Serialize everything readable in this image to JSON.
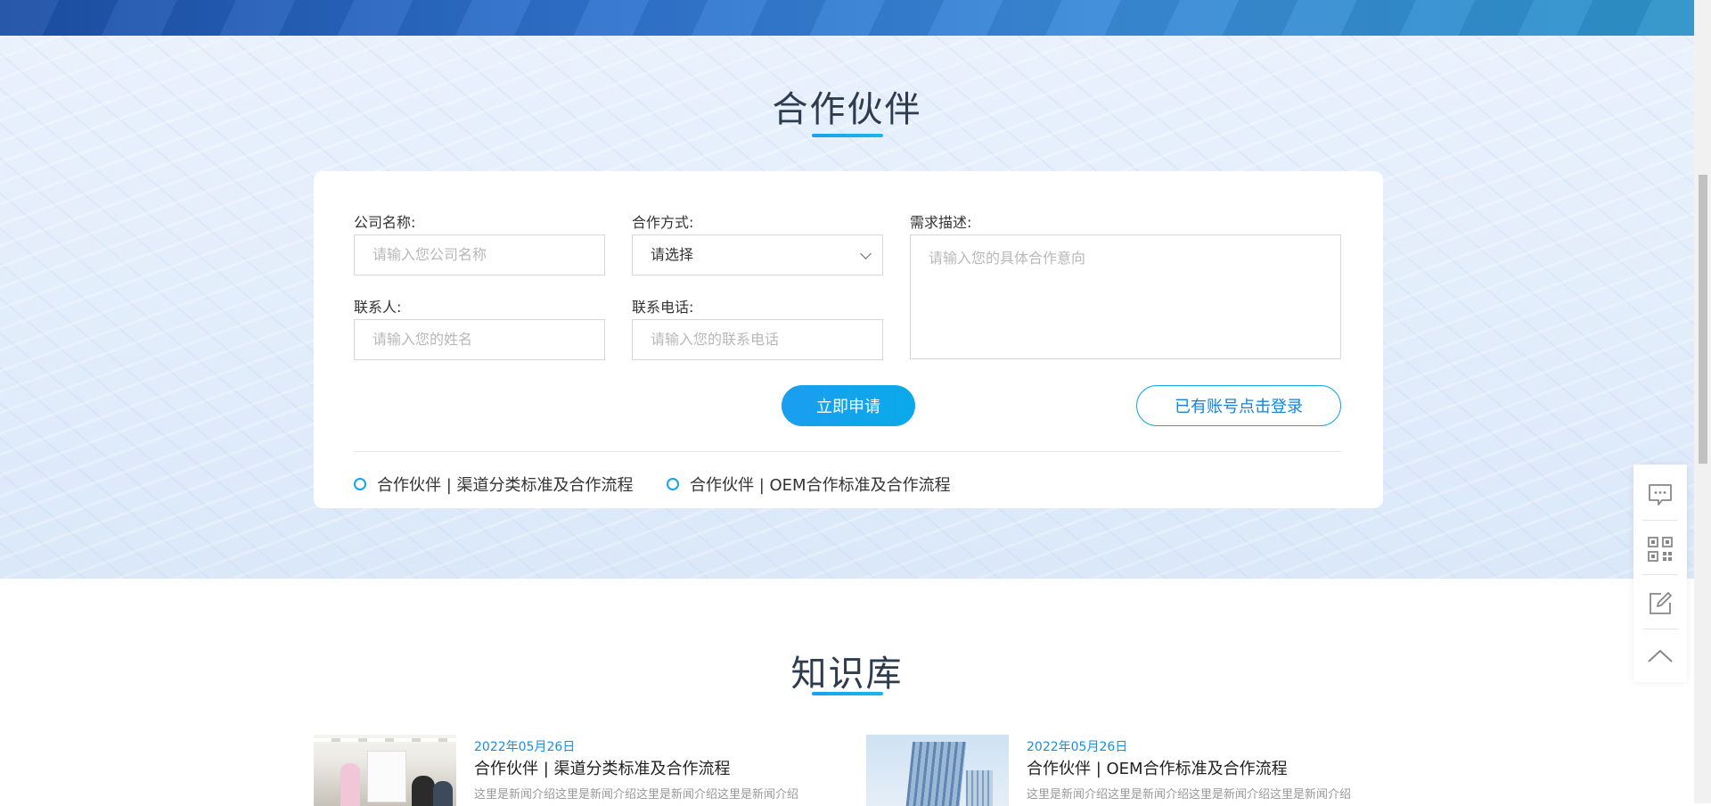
{
  "partner": {
    "title": "合作伙伴",
    "form": {
      "company_label": "公司名称:",
      "company_placeholder": "请输入您公司名称",
      "method_label": "合作方式:",
      "method_value": "请选择",
      "demand_label": "需求描述:",
      "demand_placeholder": "请输入您的具体合作意向",
      "contact_label": "联系人:",
      "contact_placeholder": "请输入您的姓名",
      "phone_label": "联系电话:",
      "phone_placeholder": "请输入您的联系电话",
      "apply_button": "立即申请",
      "login_button": "已有账号点击登录"
    },
    "links": [
      "合作伙伴 | 渠道分类标准及合作流程",
      "合作伙伴 | OEM合作标准及合作流程"
    ]
  },
  "knowledge": {
    "title": "知识库",
    "news": [
      {
        "date": "2022年05月26日",
        "title": "合作伙伴 | 渠道分类标准及合作流程",
        "desc": "这里是新闻介绍这里是新闻介绍这里是新闻介绍这里是新闻介绍"
      },
      {
        "date": "2022年05月26日",
        "title": "合作伙伴 | OEM合作标准及合作流程",
        "desc": "这里是新闻介绍这里是新闻介绍这里是新闻介绍这里是新闻介绍"
      }
    ]
  },
  "float_bar": {
    "icons": [
      "message-icon",
      "qrcode-icon",
      "edit-icon",
      "back-to-top-icon"
    ]
  },
  "colors": {
    "accent": "#14a6e8",
    "title": "#2d3c4f",
    "date": "#1a8fe0"
  }
}
